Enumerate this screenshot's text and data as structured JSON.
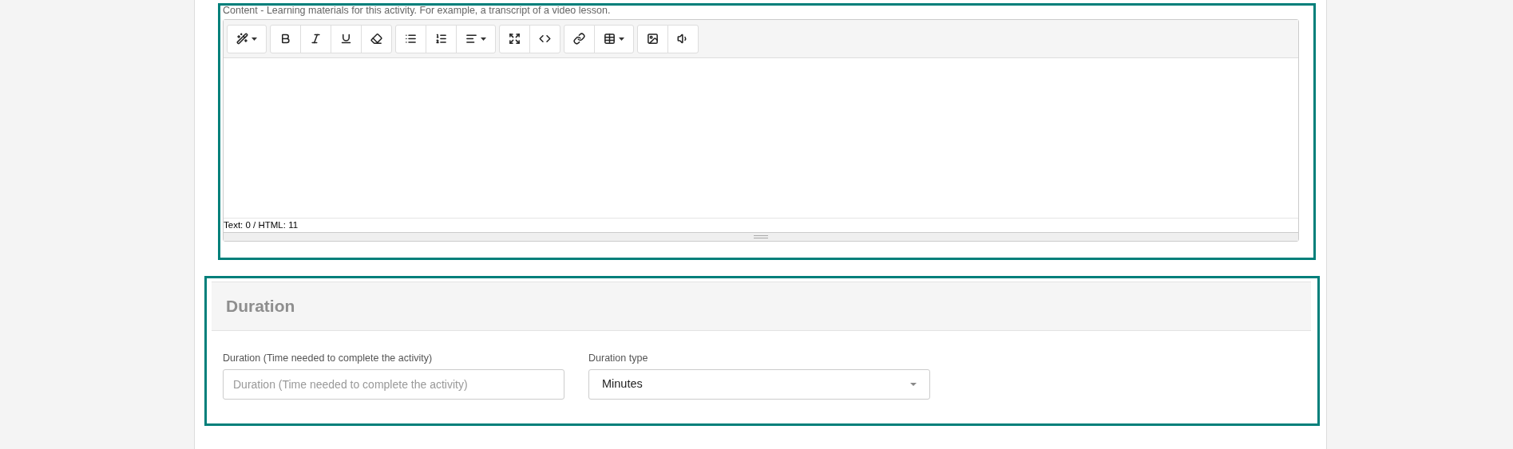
{
  "content_field": {
    "label": "Content - Learning materials for this activity. For example, a transcript of a video lesson.",
    "status": "Text: 0 / HTML: 11"
  },
  "duration_section": {
    "title": "Duration",
    "fields": [
      {
        "kind": "input",
        "label": "Duration (Time needed to complete the activity)",
        "placeholder": "Duration (Time needed to complete the activity)"
      },
      {
        "kind": "select",
        "label": "Duration type",
        "value": "Minutes"
      }
    ]
  }
}
